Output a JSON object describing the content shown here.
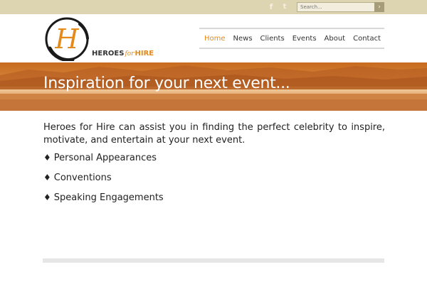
{
  "topbar": {
    "social": [
      {
        "name": "facebook-icon",
        "glyph": "f"
      },
      {
        "name": "twitter-icon",
        "glyph": "t"
      }
    ],
    "search": {
      "placeholder": "Search...",
      "button_glyph": "›"
    }
  },
  "logo": {
    "letter": "H",
    "word_heroes": "HEROES",
    "word_for": "for",
    "word_hire": "HIRE"
  },
  "nav": {
    "items": [
      "Home",
      "News",
      "Clients",
      "Events",
      "About",
      "Contact"
    ],
    "active": "Home"
  },
  "banner": {
    "title": "Inspiration for your next event..."
  },
  "content": {
    "intro": "Heroes for Hire can assist you in finding the perfect celebrity to inspire, motivate, and entertain at your next event.",
    "bullet_glyph": "♦",
    "items": [
      "Personal Appearances",
      "Conventions",
      "Speaking Engagements"
    ]
  },
  "colors": {
    "accent": "#e48a1a",
    "topbar": "#ddd4b2",
    "text": "#222222"
  }
}
